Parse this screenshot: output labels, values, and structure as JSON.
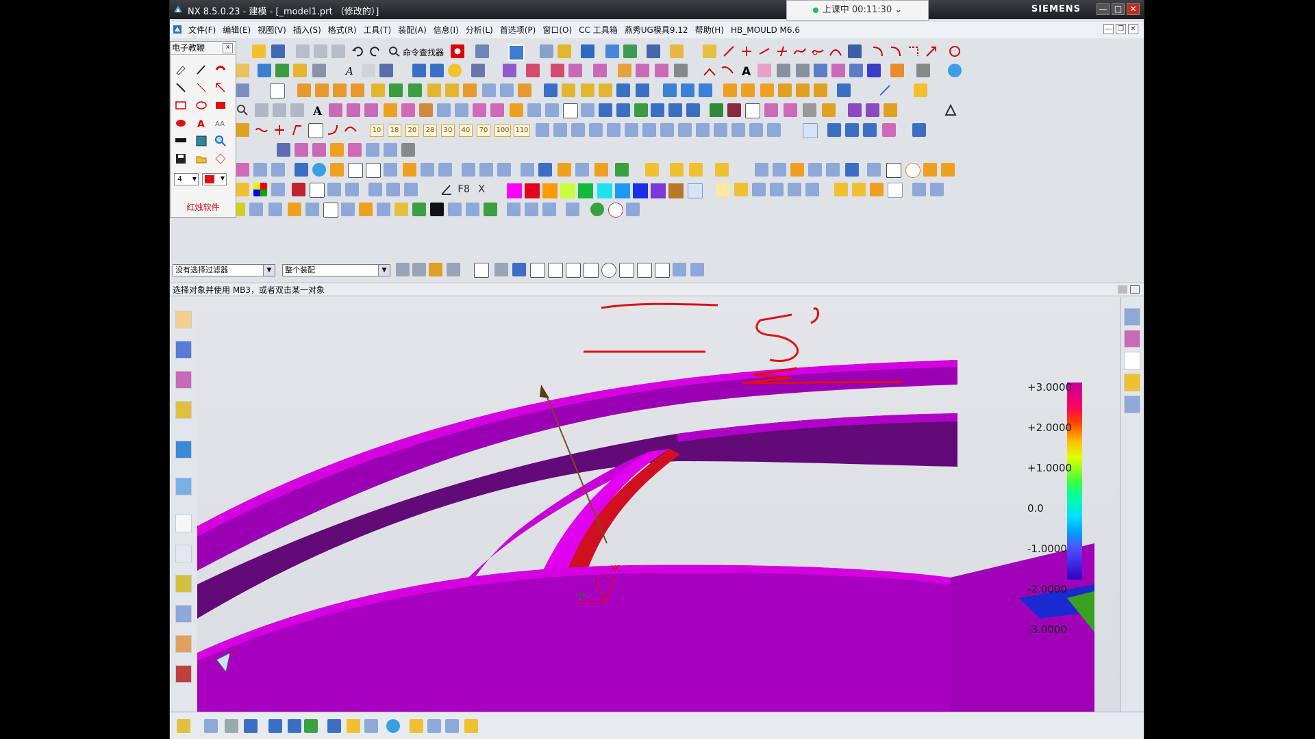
{
  "window": {
    "title": "NX 8.5.0.23 - 建模 - [_model1.prt （修改的）]",
    "brand": "SIEMENS",
    "minimize": "—",
    "maximize": "□",
    "close": "✕"
  },
  "timer": {
    "label": "上课中 00:11:30",
    "chevron": "⌄"
  },
  "menu": {
    "items": [
      "文件(F)",
      "编辑(E)",
      "视图(V)",
      "插入(S)",
      "格式(R)",
      "工具(T)",
      "装配(A)",
      "信息(I)",
      "分析(L)",
      "首选项(P)",
      "窗口(O)",
      "CC 工具箱",
      "燕秀UG模具9.12",
      "帮助(H)",
      "HB_MOULD M6.6"
    ],
    "child_min": "—",
    "child_restore": "❐",
    "child_close": "✕"
  },
  "toolbar": {
    "command_finder": "命令查找器",
    "number_buttons": [
      "10",
      "18",
      "20",
      "28",
      "30",
      "40",
      "70",
      "100",
      "110"
    ],
    "text_tools": {
      "a_letter": "A",
      "f8": "F8",
      "x_letter": "X"
    }
  },
  "palette": {
    "title": "电子教鞭",
    "close": "x",
    "footer": "红烛软件",
    "width_value": "4"
  },
  "filters": {
    "type_filter": "没有选择过滤器",
    "scope_filter": "整个装配"
  },
  "status": {
    "message": "选择对象并使用 MB3，或者双击某一对象"
  },
  "legend": {
    "labels": [
      "+3.0000",
      "+2.0000",
      "+1.0000",
      "0.0",
      "-1.0000",
      "-2.0000",
      "-3.0000"
    ]
  },
  "viewport": {
    "csys_labels": {
      "xc": "XC",
      "zc": "ZC",
      "yc": "YC"
    },
    "triad_x": "X"
  },
  "colors": {
    "accent": "#cc00cc",
    "annotation_red": "#e01010",
    "part_magenta": "#b200c8"
  }
}
